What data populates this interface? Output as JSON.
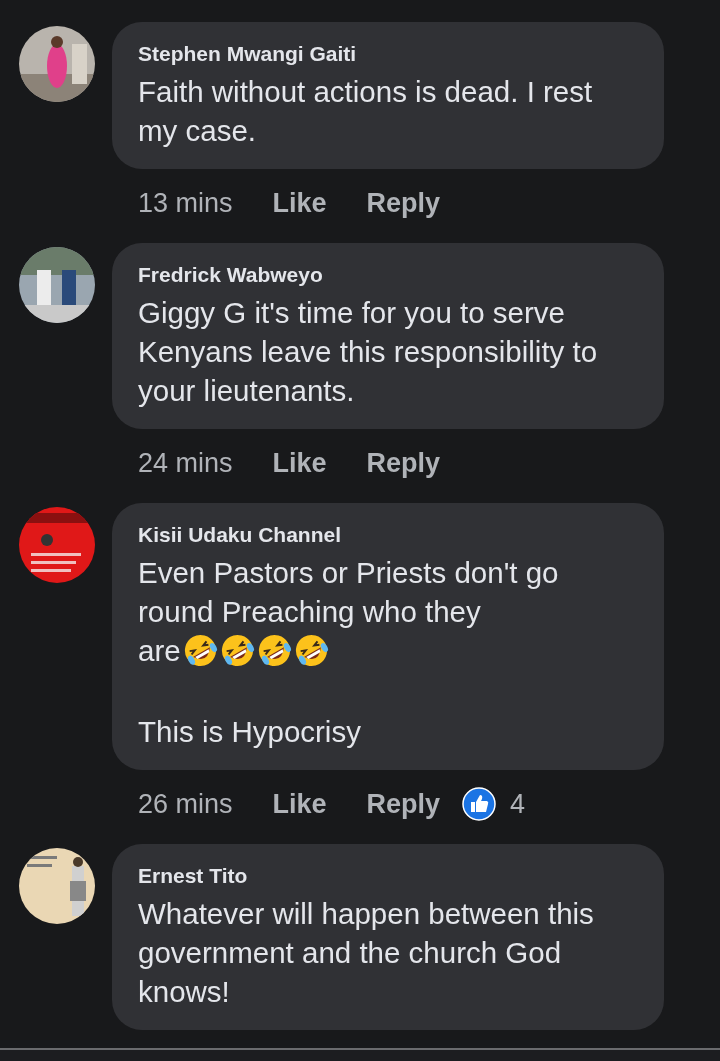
{
  "comments": [
    {
      "author": "Stephen Mwangi Gaiti",
      "avatar": {
        "kind": "picture"
      },
      "paragraphs": [
        {
          "text": "Faith without actions is dead. I rest my case."
        }
      ],
      "time": "13 mins",
      "like": "Like",
      "reply": "Reply"
    },
    {
      "author": "Fredrick Wabweyo",
      "avatar": {
        "kind": "picture"
      },
      "paragraphs": [
        {
          "text": "Giggy G it's time for you to serve Kenyans leave this responsibility to your lieutenants."
        }
      ],
      "time": "24 mins",
      "like": "Like",
      "reply": "Reply"
    },
    {
      "author": "Kisii Udaku Channel",
      "avatar": {
        "kind": "picture"
      },
      "paragraphs": [
        {
          "text": "Even Pastors or Priests don't go round Preaching who they are",
          "emojis": [
            {
              "kind": "rolling-laughing"
            },
            {
              "kind": "rolling-laughing"
            },
            {
              "kind": "rolling-laughing"
            },
            {
              "kind": "rolling-laughing"
            }
          ]
        },
        {
          "text": "This is Hypocrisy"
        }
      ],
      "time": "26 mins",
      "like": "Like",
      "reply": "Reply",
      "reactions": {
        "kind": "like",
        "count": "4"
      }
    },
    {
      "author": "Ernest Tito",
      "avatar": {
        "kind": "picture"
      },
      "paragraphs": [
        {
          "text": "Whatever will happen between this government and the church God knows!"
        }
      ]
    }
  ]
}
